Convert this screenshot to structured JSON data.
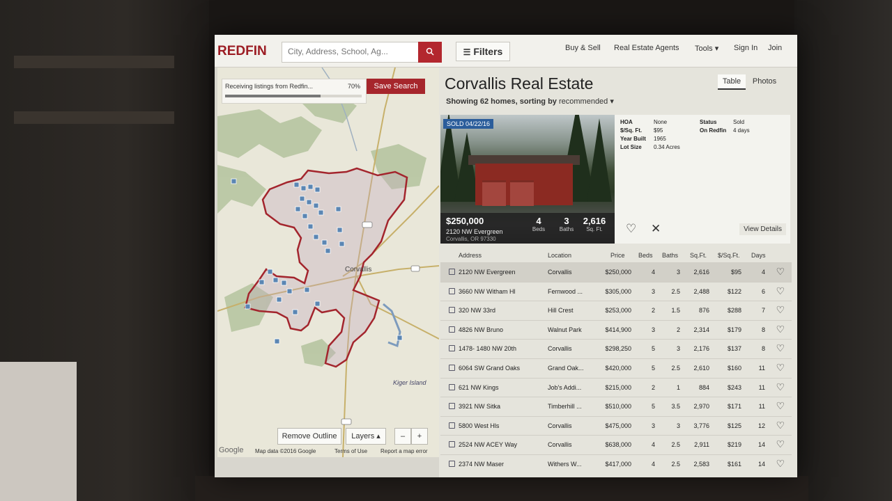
{
  "header": {
    "logo": "REDFIN",
    "search_placeholder": "City, Address, School, Ag...",
    "search_icon": "search-icon",
    "filters_label": "Filters",
    "nav": [
      "Buy & Sell",
      "Real Estate Agents",
      "Tools ▾",
      "Sign In",
      "Join"
    ]
  },
  "map": {
    "progress_text": "Receiving listings from Redfin...",
    "progress_pct": "70%",
    "progress_value": 0.7,
    "save_search": "Save Search",
    "city_label": "Corvallis",
    "place_label": "Kiger Island",
    "remove_outline": "Remove Outline",
    "layers": "Layers ▴",
    "zoom_out": "–",
    "zoom_in": "+",
    "attribution": "Google",
    "map_data": "Map data ©2016 Google",
    "terms": "Terms of Use",
    "report": "Report a map error"
  },
  "results": {
    "title": "Corvallis Real Estate",
    "showing_prefix": "Showing",
    "showing_count": "62 homes",
    "sorting_text": ", sorting by",
    "sort_value": "recommended ▾",
    "view_table": "Table",
    "view_photos": "Photos"
  },
  "featured": {
    "badge": "SOLD 04/22/16",
    "price": "$250,000",
    "address": "2120 NW Evergreen",
    "city": "Corvallis, OR 97330",
    "beds": "4",
    "beds_label": "Beds",
    "baths": "3",
    "baths_label": "Baths",
    "sqft": "2,616",
    "sqft_label": "Sq. Ft.",
    "details": {
      "hoa_label": "HOA",
      "hoa": "None",
      "sqft_price_label": "$/Sq. Ft.",
      "sqft_price": "$95",
      "year_label": "Year Built",
      "year": "1965",
      "lot_label": "Lot Size",
      "lot": "0.34 Acres",
      "status_label": "Status",
      "status": "Sold",
      "onredfin_label": "On Redfin",
      "onredfin": "4 days"
    },
    "view_details": "View Details"
  },
  "table": {
    "headers": [
      "Address",
      "Location",
      "Price",
      "Beds",
      "Baths",
      "Sq.Ft.",
      "$/Sq.Ft.",
      "Days"
    ],
    "rows": [
      [
        "2120 NW Evergreen",
        "Corvallis",
        "$250,000",
        "4",
        "3",
        "2,616",
        "$95",
        "4"
      ],
      [
        "3660 NW Witham Hl",
        "Fernwood ...",
        "$305,000",
        "3",
        "2.5",
        "2,488",
        "$122",
        "6"
      ],
      [
        "320 NW 33rd",
        "Hill Crest",
        "$253,000",
        "2",
        "1.5",
        "876",
        "$288",
        "7"
      ],
      [
        "4826 NW Bruno",
        "Walnut Park",
        "$414,900",
        "3",
        "2",
        "2,314",
        "$179",
        "8"
      ],
      [
        "1478- 1480 NW 20th",
        "Corvallis",
        "$298,250",
        "5",
        "3",
        "2,176",
        "$137",
        "8"
      ],
      [
        "6064 SW Grand Oaks",
        "Grand Oak...",
        "$420,000",
        "5",
        "2.5",
        "2,610",
        "$160",
        "11"
      ],
      [
        "621 NW Kings",
        "Job's Addi...",
        "$215,000",
        "2",
        "1",
        "884",
        "$243",
        "11"
      ],
      [
        "3921 NW Sitka",
        "Timberhill ...",
        "$510,000",
        "5",
        "3.5",
        "2,970",
        "$171",
        "11"
      ],
      [
        "5800 West Hls",
        "Corvallis",
        "$475,000",
        "3",
        "3",
        "3,776",
        "$125",
        "12"
      ],
      [
        "2524 NW ACEY Way",
        "Corvallis",
        "$638,000",
        "4",
        "2.5",
        "2,911",
        "$219",
        "14"
      ],
      [
        "2374 NW Maser",
        "Withers W...",
        "$417,000",
        "4",
        "2.5",
        "2,583",
        "$161",
        "14"
      ]
    ]
  },
  "colors": {
    "brand": "#9c1c23",
    "map_bg": "#e9e7d9",
    "outline": "#a3252d",
    "pin": "#5b86b3"
  }
}
